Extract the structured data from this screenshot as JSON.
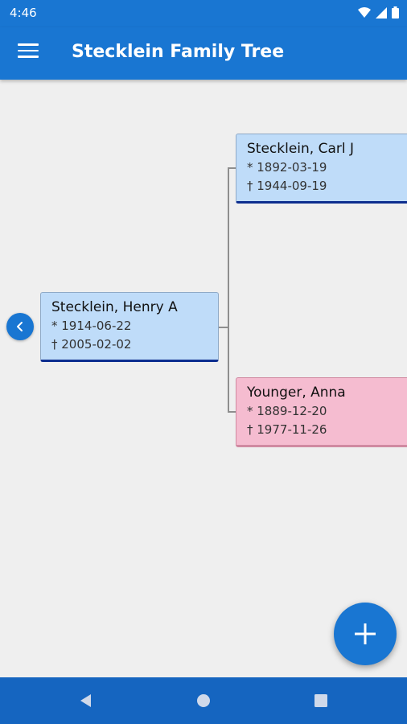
{
  "status_bar": {
    "time": "4:46"
  },
  "app_bar": {
    "title": "Stecklein Family Tree"
  },
  "tree": {
    "root": {
      "name": "Stecklein, Henry A",
      "birth": "* 1914-06-22",
      "death": "† 2005-02-02"
    },
    "father": {
      "name": "Stecklein, Carl J",
      "birth": "* 1892-03-19",
      "death": "† 1944-09-19"
    },
    "mother": {
      "name": "Younger, Anna",
      "birth": "* 1889-12-20",
      "death": "† 1977-11-26"
    }
  },
  "colors": {
    "primary": "#1976d2",
    "male_card": "#bfdcf9",
    "female_card": "#f5bcd0"
  },
  "icons": {
    "menu": "menu-icon",
    "back": "chevron-left-icon",
    "fab": "plus-icon"
  }
}
